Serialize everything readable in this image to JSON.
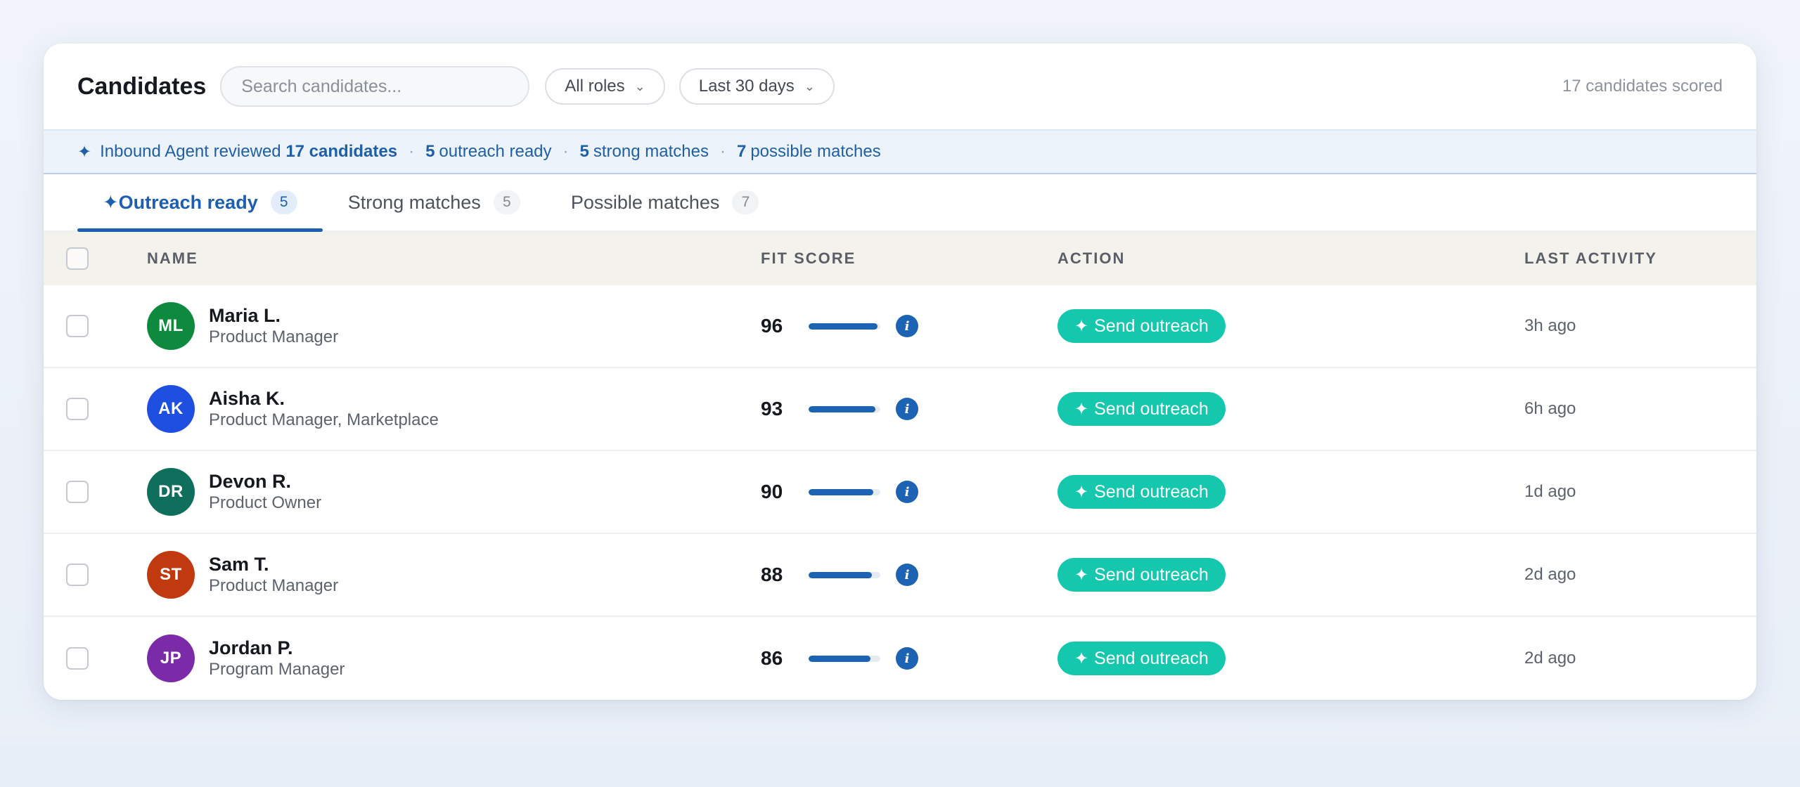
{
  "header": {
    "title": "Candidates",
    "search_placeholder": "Search candidates...",
    "role_filter": "All roles",
    "date_filter": "Last 30 days",
    "scored_count": "17 candidates scored"
  },
  "banner": {
    "prefix": "Inbound Agent reviewed",
    "reviewed": "17 candidates",
    "outreach_num": "5",
    "outreach_text": "outreach ready",
    "strong_num": "5",
    "strong_text": "strong matches",
    "possible_num": "7",
    "possible_text": "possible matches",
    "separator": "·"
  },
  "tabs": [
    {
      "label": "Outreach ready",
      "count": "5",
      "active": true
    },
    {
      "label": "Strong matches",
      "count": "5",
      "active": false
    },
    {
      "label": "Possible matches",
      "count": "7",
      "active": false
    }
  ],
  "columns": {
    "name": "NAME",
    "fit": "FIT SCORE",
    "action": "ACTION",
    "last": "LAST ACTIVITY"
  },
  "action_label": "Send outreach",
  "icons": {
    "spark": "sparkle-icon",
    "chevron": "chevron-down-icon",
    "info": "info-icon"
  },
  "colors": {
    "accent": "#1d63b3",
    "send_button": "#14c7ad"
  },
  "candidates": [
    {
      "initials": "ML",
      "name": "Maria L.",
      "role": "Product Manager",
      "score": "96",
      "fit": 0.96,
      "last": "3h ago",
      "color": "#0e8a3e"
    },
    {
      "initials": "AK",
      "name": "Aisha K.",
      "role": "Product Manager, Marketplace",
      "score": "93",
      "fit": 0.93,
      "last": "6h ago",
      "color": "#1f4fe0"
    },
    {
      "initials": "DR",
      "name": "Devon R.",
      "role": "Product Owner",
      "score": "90",
      "fit": 0.9,
      "last": "1d ago",
      "color": "#0f6e5c"
    },
    {
      "initials": "ST",
      "name": "Sam T.",
      "role": "Product Manager",
      "score": "88",
      "fit": 0.88,
      "last": "2d ago",
      "color": "#c0390f"
    },
    {
      "initials": "JP",
      "name": "Jordan P.",
      "role": "Program Manager",
      "score": "86",
      "fit": 0.86,
      "last": "2d ago",
      "color": "#7b2aa8"
    }
  ]
}
